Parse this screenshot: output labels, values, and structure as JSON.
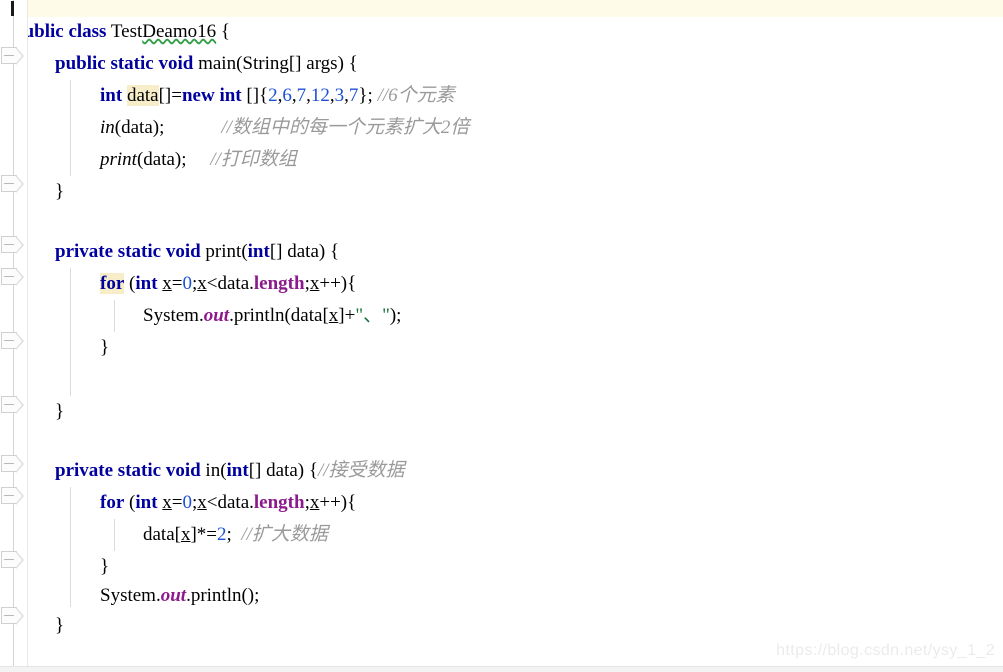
{
  "editor": {
    "watermark": "https://blog.csdn.net/ysy_1_2",
    "caret_line": 1,
    "colors": {
      "background": "#ffffff",
      "current_line": "#fefce8",
      "keyword": "#00009f",
      "number": "#1a4fd6",
      "string": "#17703a",
      "comment": "#9a9a9a",
      "field": "#8d1a8d",
      "occurrence_highlight": "#f7edc8",
      "gutter_border": "#e8e8e8",
      "indent_guide": "#dcdcdc",
      "spellcheck_squiggle": "#2f9e44"
    }
  },
  "code": {
    "class_name": "TestDeamo16",
    "lines": {
      "l1_kw_public": "public",
      "l1_kw_class": "class",
      "l1_name_a": "Test",
      "l1_name_b": "Deamo16",
      "l1_brace": "{",
      "l2_kw_public": "public",
      "l2_kw_static": "static",
      "l2_kw_void": "void",
      "l2_main": "main",
      "l2_sig": "(String[] args) {",
      "l3_kw_int": "int",
      "l3_var": "data",
      "l3_eq": "[]=",
      "l3_kw_new": "new",
      "l3_kw_int2": "int",
      "l3_open": " []{",
      "l3_n1": "2",
      "l3_n2": "6",
      "l3_n3": "7",
      "l3_n4": "12",
      "l3_n5": "3",
      "l3_n6": "7",
      "l3_close": "};",
      "l3_comment": "//6个元素",
      "l4_call": "in",
      "l4_args": "(data);",
      "l4_comment": "//数组中的每一个元素扩大2倍",
      "l5_call": "print",
      "l5_args": "(data);",
      "l5_comment": "//打印数组",
      "l6_close": "}",
      "l8_kw_private": "private",
      "l8_kw_static": "static",
      "l8_kw_void": "void",
      "l8_name": "print",
      "l8_paren1": "(",
      "l8_kw_int": "int",
      "l8_sig": "[] data) {",
      "l9_kw_for": "for",
      "l9_open": " (",
      "l9_kw_int": "int",
      "l9_x1": "x",
      "l9_eq": "=",
      "l9_zero": "0",
      "l9_semi1": ";",
      "l9_x2": "x",
      "l9_lt": "<data.",
      "l9_length": "length",
      "l9_semi2": ";",
      "l9_x3": "x",
      "l9_tail": "++){",
      "l10_sys": "System.",
      "l10_out": "out",
      "l10_print": ".println(data[",
      "l10_x": "x",
      "l10_plus": "]+",
      "l10_str": "\"、\"",
      "l10_tail": ");",
      "l11_close": "}",
      "l13_close": "}",
      "l15_kw_private": "private",
      "l15_kw_static": "static",
      "l15_kw_void": "void",
      "l15_name": "in",
      "l15_paren1": "(",
      "l15_kw_int": "int",
      "l15_sig": "[] data) {",
      "l15_comment": "//接受数据",
      "l16_kw_for": "for",
      "l16_open": " (",
      "l16_kw_int": "int",
      "l16_x1": "x",
      "l16_eq": "=",
      "l16_zero": "0",
      "l16_semi1": ";",
      "l16_x2": "x",
      "l16_lt": "<data.",
      "l16_length": "length",
      "l16_semi2": ";",
      "l16_x3": "x",
      "l16_tail": "++){",
      "l17_data": "data[",
      "l17_x": "x",
      "l17_op": "]*=",
      "l17_two": "2",
      "l17_semi": ";",
      "l17_comment": "//扩大数据",
      "l18_close": "}",
      "l19_sys": "System.",
      "l19_out": "out",
      "l19_print": ".println();",
      "l20_close": "}",
      "l21_close": "}"
    }
  }
}
